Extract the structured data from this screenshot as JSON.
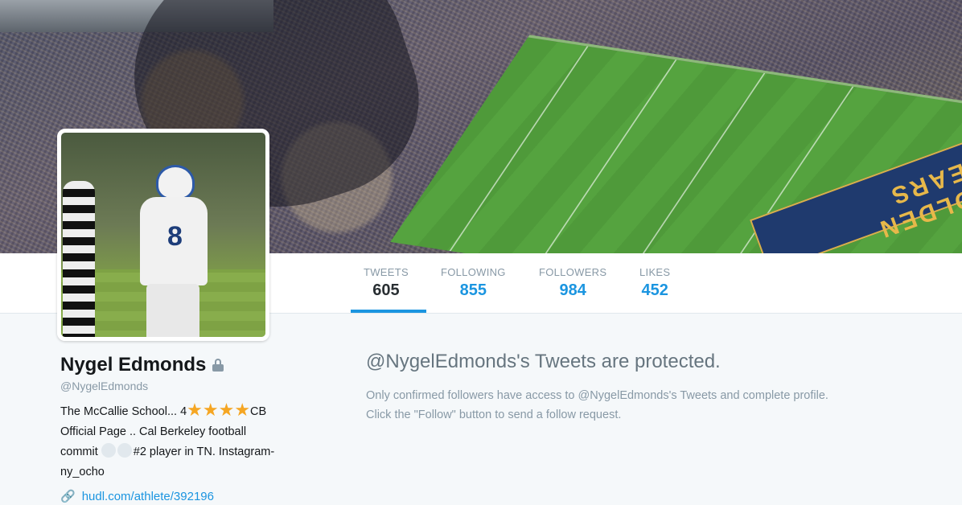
{
  "banner": {
    "endzone_text": "GOLDEN BEARS"
  },
  "stats": [
    {
      "label": "TWEETS",
      "value": "605",
      "active": true
    },
    {
      "label": "FOLLOWING",
      "value": "855"
    },
    {
      "label": "FOLLOWERS",
      "value": "984"
    },
    {
      "label": "LIKES",
      "value": "452"
    }
  ],
  "avatar": {
    "jersey_number": "8"
  },
  "profile": {
    "name": "Nygel Edmonds",
    "handle": "@NygelEdmonds",
    "bio_part1": "The McCallie School... 4",
    "bio_stars": "★★★★",
    "bio_part2": "CB",
    "bio_line2": "Official Page .. Cal Berkeley football",
    "bio_line3_pre": "commit",
    "bio_line3_post": "#2 player in TN. Instagram-",
    "bio_line4": "ny_ocho",
    "link": "hudl.com/athlete/392196"
  },
  "protected": {
    "title": "@NygelEdmonds's Tweets are protected.",
    "line1": "Only confirmed followers have access to @NygelEdmonds's Tweets and complete profile.",
    "line2": "Click the \"Follow\" button to send a follow request."
  },
  "icons": {
    "lock": "lock-icon",
    "link": "link-icon",
    "star": "star-icon"
  }
}
